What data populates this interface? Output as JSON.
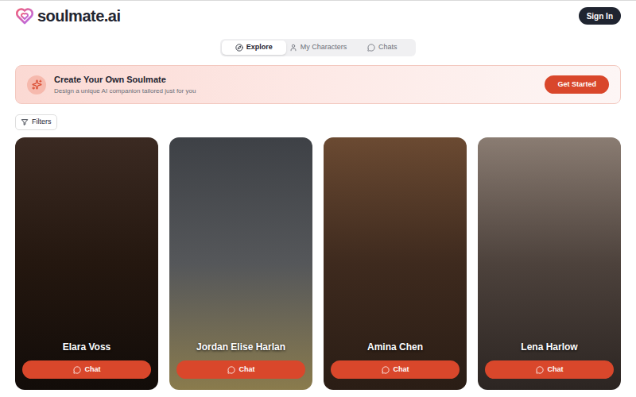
{
  "header": {
    "logo": "soulmate.ai",
    "sign_in": "Sign In"
  },
  "tabs": [
    {
      "label": "Explore",
      "selected": true
    },
    {
      "label": "My Characters",
      "selected": false
    },
    {
      "label": "Chats",
      "selected": false
    }
  ],
  "banner": {
    "title": "Create Your Own Soulmate",
    "subtitle": "Design a unique AI companion tailored just for you",
    "button": "Get Started"
  },
  "filters": {
    "label": "Filters"
  },
  "cards": [
    {
      "name": "Elara Voss",
      "button": "Chat"
    },
    {
      "name": "Jordan Elise Harlan",
      "button": "Chat"
    },
    {
      "name": "Amina Chen",
      "button": "Chat"
    },
    {
      "name": "Lena Harlow",
      "button": "Chat"
    }
  ]
}
